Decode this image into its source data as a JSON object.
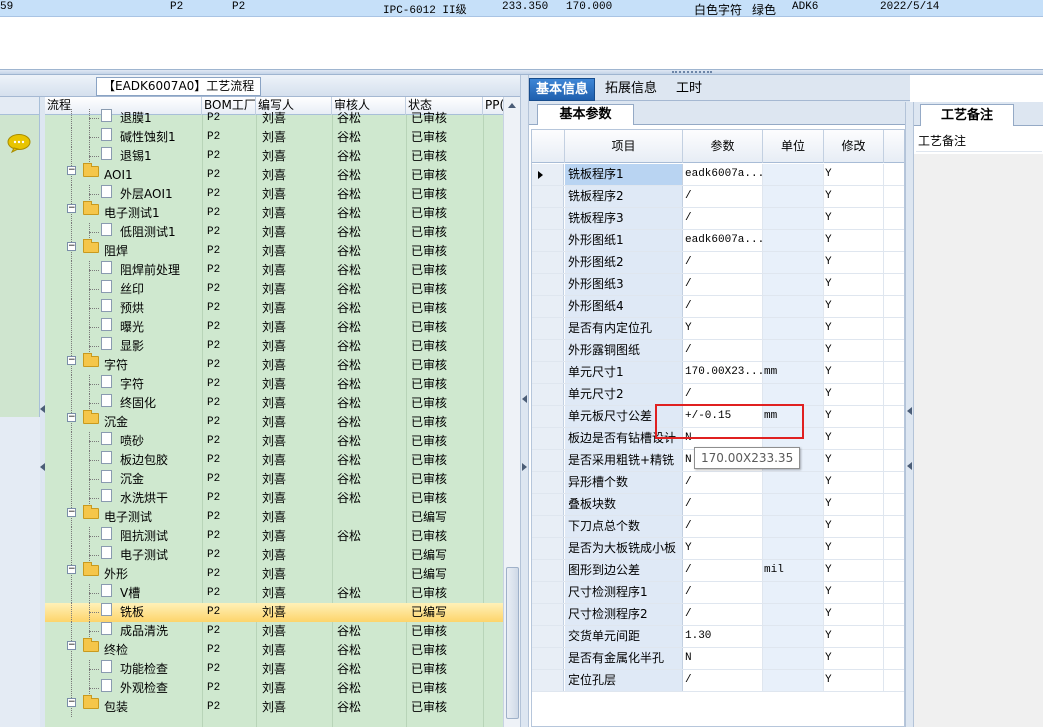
{
  "top_row": {
    "cells": [
      "59",
      "P2",
      "P2",
      "IPC-6012 II级",
      "233.350",
      "170.000",
      "白色字符",
      "绿色",
      "ADK6",
      "2022/5/14"
    ]
  },
  "left_panel": {
    "flow_tab": "【EADK6007A0】工艺流程",
    "columns": [
      "流程",
      "BOM工厂",
      "编写人",
      "审核人",
      "状态",
      "PP("
    ],
    "rows": [
      {
        "name": "退膜1",
        "bom": "P2",
        "writer": "刘喜",
        "reviewer": "谷松",
        "status": "已审核",
        "type": "leaf"
      },
      {
        "name": "碱性蚀刻1",
        "bom": "P2",
        "writer": "刘喜",
        "reviewer": "谷松",
        "status": "已审核",
        "type": "leaf"
      },
      {
        "name": "退锡1",
        "bom": "P2",
        "writer": "刘喜",
        "reviewer": "谷松",
        "status": "已审核",
        "type": "leaf"
      },
      {
        "name": "AOI1",
        "bom": "P2",
        "writer": "刘喜",
        "reviewer": "谷松",
        "status": "已审核",
        "type": "group"
      },
      {
        "name": "外层AOI1",
        "bom": "P2",
        "writer": "刘喜",
        "reviewer": "谷松",
        "status": "已审核",
        "type": "leaf"
      },
      {
        "name": "电子测试1",
        "bom": "P2",
        "writer": "刘喜",
        "reviewer": "谷松",
        "status": "已审核",
        "type": "group"
      },
      {
        "name": "低阻测试1",
        "bom": "P2",
        "writer": "刘喜",
        "reviewer": "谷松",
        "status": "已审核",
        "type": "leaf"
      },
      {
        "name": "阻焊",
        "bom": "P2",
        "writer": "刘喜",
        "reviewer": "谷松",
        "status": "已审核",
        "type": "group"
      },
      {
        "name": "阻焊前处理",
        "bom": "P2",
        "writer": "刘喜",
        "reviewer": "谷松",
        "status": "已审核",
        "type": "leaf"
      },
      {
        "name": "丝印",
        "bom": "P2",
        "writer": "刘喜",
        "reviewer": "谷松",
        "status": "已审核",
        "type": "leaf"
      },
      {
        "name": "预烘",
        "bom": "P2",
        "writer": "刘喜",
        "reviewer": "谷松",
        "status": "已审核",
        "type": "leaf"
      },
      {
        "name": "曝光",
        "bom": "P2",
        "writer": "刘喜",
        "reviewer": "谷松",
        "status": "已审核",
        "type": "leaf"
      },
      {
        "name": "显影",
        "bom": "P2",
        "writer": "刘喜",
        "reviewer": "谷松",
        "status": "已审核",
        "type": "leaf"
      },
      {
        "name": "字符",
        "bom": "P2",
        "writer": "刘喜",
        "reviewer": "谷松",
        "status": "已审核",
        "type": "group"
      },
      {
        "name": "字符",
        "bom": "P2",
        "writer": "刘喜",
        "reviewer": "谷松",
        "status": "已审核",
        "type": "leaf"
      },
      {
        "name": "终固化",
        "bom": "P2",
        "writer": "刘喜",
        "reviewer": "谷松",
        "status": "已审核",
        "type": "leaf"
      },
      {
        "name": "沉金",
        "bom": "P2",
        "writer": "刘喜",
        "reviewer": "谷松",
        "status": "已审核",
        "type": "group"
      },
      {
        "name": "喷砂",
        "bom": "P2",
        "writer": "刘喜",
        "reviewer": "谷松",
        "status": "已审核",
        "type": "leaf"
      },
      {
        "name": "板边包胶",
        "bom": "P2",
        "writer": "刘喜",
        "reviewer": "谷松",
        "status": "已审核",
        "type": "leaf"
      },
      {
        "name": "沉金",
        "bom": "P2",
        "writer": "刘喜",
        "reviewer": "谷松",
        "status": "已审核",
        "type": "leaf"
      },
      {
        "name": "水洗烘干",
        "bom": "P2",
        "writer": "刘喜",
        "reviewer": "谷松",
        "status": "已审核",
        "type": "leaf"
      },
      {
        "name": "电子测试",
        "bom": "P2",
        "writer": "刘喜",
        "reviewer": "",
        "status": "已编写",
        "type": "group"
      },
      {
        "name": "阻抗测试",
        "bom": "P2",
        "writer": "刘喜",
        "reviewer": "谷松",
        "status": "已审核",
        "type": "leaf"
      },
      {
        "name": "电子测试",
        "bom": "P2",
        "writer": "刘喜",
        "reviewer": "",
        "status": "已编写",
        "type": "leaf"
      },
      {
        "name": "外形",
        "bom": "P2",
        "writer": "刘喜",
        "reviewer": "",
        "status": "已编写",
        "type": "group"
      },
      {
        "name": "V槽",
        "bom": "P2",
        "writer": "刘喜",
        "reviewer": "谷松",
        "status": "已审核",
        "type": "leaf"
      },
      {
        "name": "铣板",
        "bom": "P2",
        "writer": "刘喜",
        "reviewer": "",
        "status": "已编写",
        "type": "leaf",
        "selected": true
      },
      {
        "name": "成品清洗",
        "bom": "P2",
        "writer": "刘喜",
        "reviewer": "谷松",
        "status": "已审核",
        "type": "leaf"
      },
      {
        "name": "终检",
        "bom": "P2",
        "writer": "刘喜",
        "reviewer": "谷松",
        "status": "已审核",
        "type": "group"
      },
      {
        "name": "功能检查",
        "bom": "P2",
        "writer": "刘喜",
        "reviewer": "谷松",
        "status": "已审核",
        "type": "leaf"
      },
      {
        "name": "外观检查",
        "bom": "P2",
        "writer": "刘喜",
        "reviewer": "谷松",
        "status": "已审核",
        "type": "leaf"
      },
      {
        "name": "包装",
        "bom": "P2",
        "writer": "刘喜",
        "reviewer": "谷松",
        "status": "已审核",
        "type": "group"
      }
    ]
  },
  "right_panel": {
    "tabs": [
      "基本信息",
      "拓展信息",
      "工时"
    ],
    "active_tab": "基本信息",
    "sub_tab": "基本参数",
    "columns": [
      "项目",
      "参数",
      "单位",
      "修改"
    ],
    "rows": [
      {
        "item": "铣板程序1",
        "value": "eadk6007a...",
        "unit": "",
        "mod": "Y"
      },
      {
        "item": "铣板程序2",
        "value": "/",
        "unit": "",
        "mod": "Y"
      },
      {
        "item": "铣板程序3",
        "value": "/",
        "unit": "",
        "mod": "Y"
      },
      {
        "item": "外形图纸1",
        "value": "eadk6007a...",
        "unit": "",
        "mod": "Y"
      },
      {
        "item": "外形图纸2",
        "value": "/",
        "unit": "",
        "mod": "Y"
      },
      {
        "item": "外形图纸3",
        "value": "/",
        "unit": "",
        "mod": "Y"
      },
      {
        "item": "外形图纸4",
        "value": "/",
        "unit": "",
        "mod": "Y"
      },
      {
        "item": "是否有内定位孔",
        "value": "Y",
        "unit": "",
        "mod": "Y"
      },
      {
        "item": "外形露铜图纸",
        "value": "/",
        "unit": "",
        "mod": "Y"
      },
      {
        "item": "单元尺寸1",
        "value": "170.00X23...",
        "unit": "mm",
        "mod": "Y"
      },
      {
        "item": "单元尺寸2",
        "value": "/",
        "unit": "",
        "mod": "Y"
      },
      {
        "item": "单元板尺寸公差",
        "value": "+/-0.15",
        "unit": "mm",
        "mod": "Y"
      },
      {
        "item": "板边是否有钻槽设计",
        "value": "N",
        "unit": "",
        "mod": "Y"
      },
      {
        "item": "是否采用粗铣+精铣",
        "value": "N",
        "unit": "",
        "mod": "Y"
      },
      {
        "item": "异形槽个数",
        "value": "/",
        "unit": "",
        "mod": "Y"
      },
      {
        "item": "叠板块数",
        "value": "/",
        "unit": "",
        "mod": "Y"
      },
      {
        "item": "下刀点总个数",
        "value": "/",
        "unit": "",
        "mod": "Y"
      },
      {
        "item": "是否为大板铣成小板",
        "value": "Y",
        "unit": "",
        "mod": "Y"
      },
      {
        "item": "图形到边公差",
        "value": "/",
        "unit": "mil",
        "mod": "Y"
      },
      {
        "item": "尺寸检测程序1",
        "value": "/",
        "unit": "",
        "mod": "Y"
      },
      {
        "item": "尺寸检测程序2",
        "value": "/",
        "unit": "",
        "mod": "Y"
      },
      {
        "item": "交货单元间距",
        "value": "1.30",
        "unit": "",
        "mod": "Y"
      },
      {
        "item": "是否有金属化半孔",
        "value": "N",
        "unit": "",
        "mod": "Y"
      },
      {
        "item": "定位孔层",
        "value": "/",
        "unit": "",
        "mod": "Y"
      }
    ],
    "tooltip": "170.00X233.35"
  },
  "remarks_panel": {
    "tab": "工艺备注",
    "label": "工艺备注"
  },
  "colors": {
    "selected_row_bg": "#fdd46b",
    "grid_green": "#cfe8cf",
    "active_tab_blue": "#2c6fc0",
    "highlight_red": "#e02020"
  }
}
